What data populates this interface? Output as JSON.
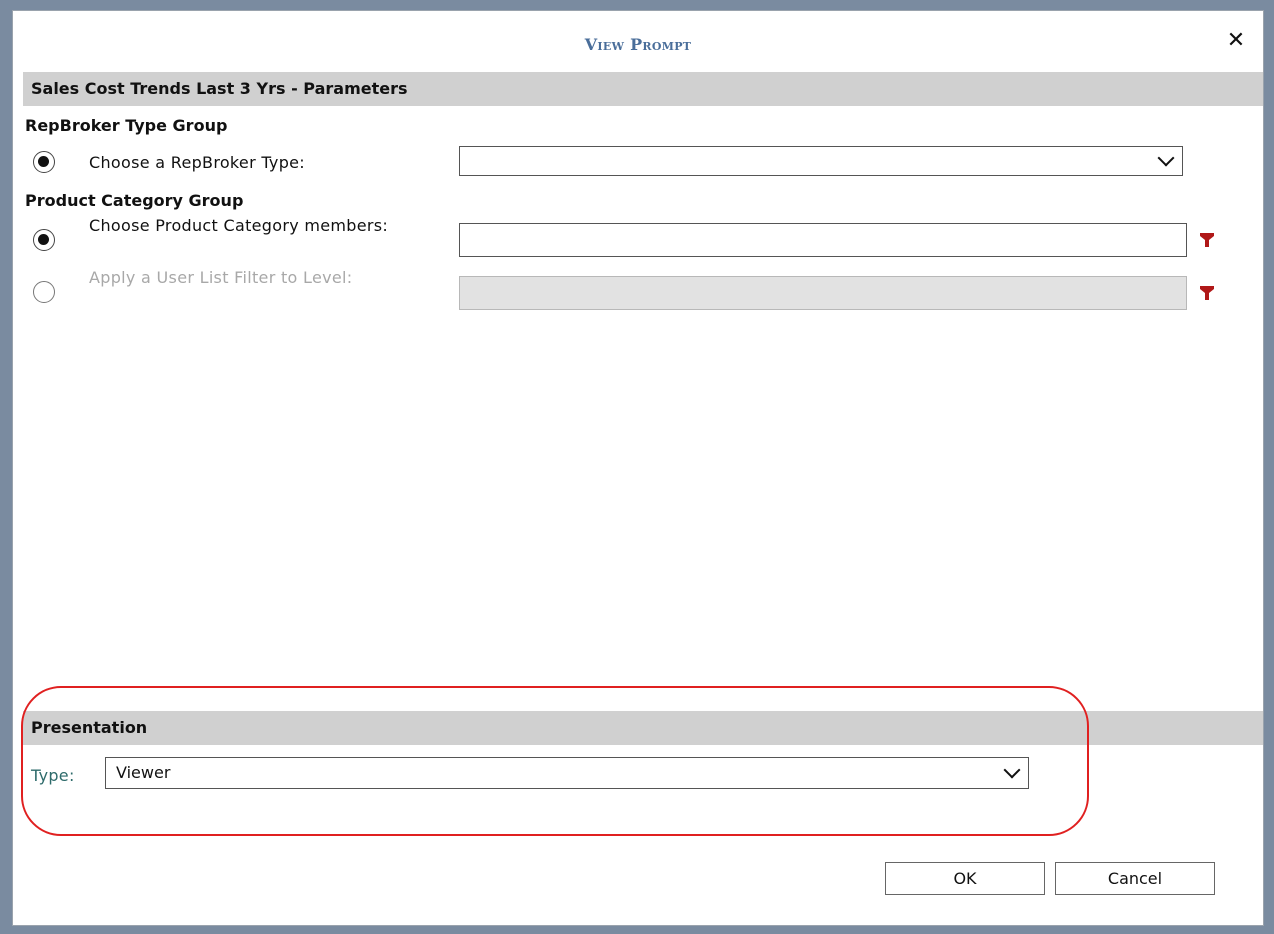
{
  "dialog": {
    "title": "View Prompt",
    "close_glyph": "✕"
  },
  "parameters": {
    "header": "Sales Cost Trends Last 3 Yrs - Parameters",
    "repbroker_group": {
      "label": "RepBroker Type Group",
      "option_label": "Choose a RepBroker Type:",
      "selected": true,
      "select_value": ""
    },
    "product_group": {
      "label": "Product Category Group",
      "option1_label": "Choose Product Category members:",
      "option1_selected": true,
      "option1_value": "",
      "option2_label": "Apply a User List Filter to Level:",
      "option2_selected": false,
      "option2_disabled": true,
      "option2_value": ""
    }
  },
  "presentation": {
    "header": "Presentation",
    "type_label": "Type:",
    "type_value": "Viewer"
  },
  "buttons": {
    "ok": "OK",
    "cancel": "Cancel"
  },
  "colors": {
    "title": "#4a6e9a",
    "filter_icon": "#b01818",
    "highlight": "#e02020",
    "section_bg": "#d0d0d0"
  },
  "icons": {
    "filter": "filter-icon",
    "close": "close-icon",
    "dropdown": "chevron-down-icon"
  }
}
